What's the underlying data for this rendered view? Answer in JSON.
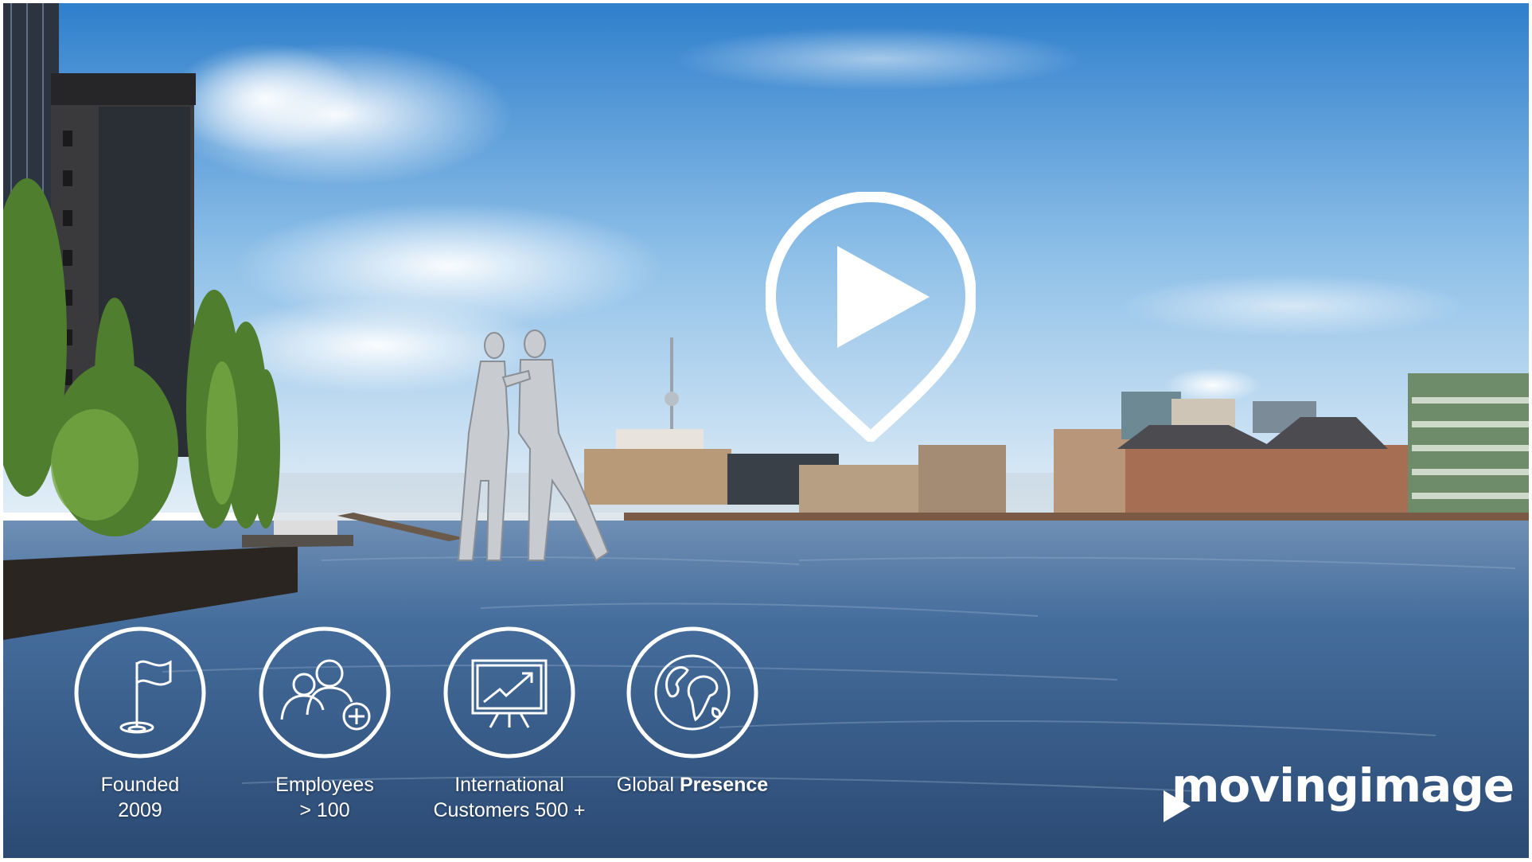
{
  "video": {
    "play_icon": "play-pin-icon"
  },
  "stats": [
    {
      "icon": "flag-icon",
      "line1": "Founded",
      "line2": "2009"
    },
    {
      "icon": "people-add-icon",
      "line1": "Employees",
      "line2": "> 100"
    },
    {
      "icon": "growth-chart-icon",
      "line1": "International",
      "line2": "Customers 500 +"
    },
    {
      "icon": "globe-icon",
      "line1_regular": "Global ",
      "line1_bold": "Presence"
    }
  ],
  "brand": {
    "wordmark": "movingimage"
  },
  "colors": {
    "sky_top": "#3d8fd6",
    "sky_bottom": "#d9ebf7",
    "water": "#3b5f8f",
    "icon_white": "#ffffff"
  }
}
